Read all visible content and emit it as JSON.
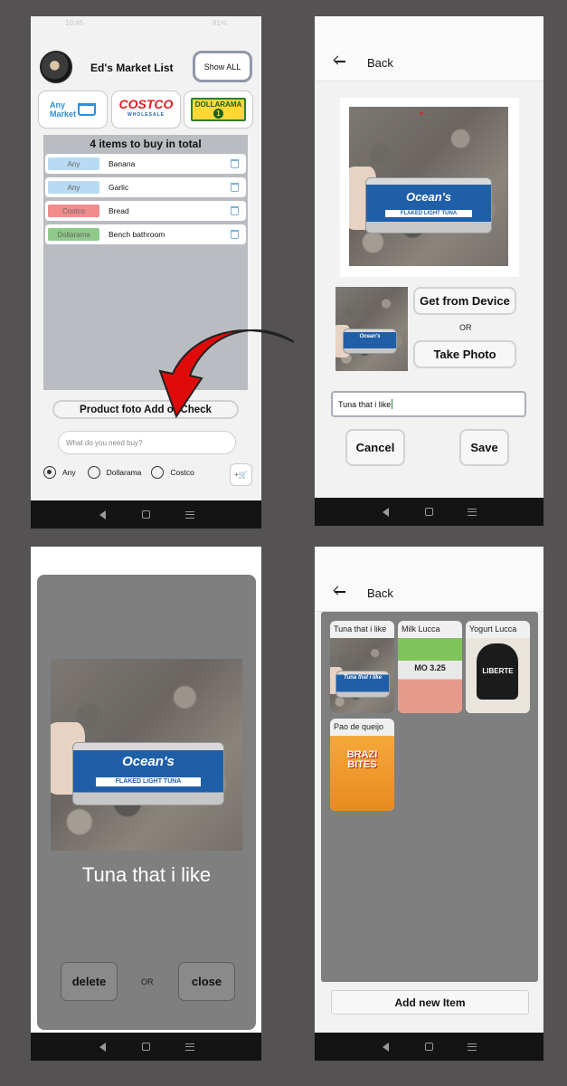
{
  "colors": {
    "background": "#545253",
    "any_tag": "#b8dbf3",
    "costco_tag": "#f28c8c",
    "dollarama_tag": "#8fca8a",
    "arrow": "#e10a0a",
    "dialog_gray": "#7f7f7f"
  },
  "screen1": {
    "status_time": "10:45",
    "status_right": "91%",
    "title": "Ed's Market List",
    "show_all": "Show ALL",
    "stores": [
      {
        "name": "Any Market",
        "line1": "Any",
        "line2": "Market",
        "icon": "cart-icon"
      },
      {
        "name": "Costco",
        "logo": "COSTCO",
        "sub": "WHOLESALE"
      },
      {
        "name": "Dollarama",
        "logo": "DOLLARAMA",
        "sub": "1"
      }
    ],
    "list_title": "4  items to buy in total",
    "items": [
      {
        "tag": "Any",
        "name": "Banana",
        "color": "#b8dbf3"
      },
      {
        "tag": "Any",
        "name": "Garlic",
        "color": "#b8dbf3"
      },
      {
        "tag": "Costco",
        "name": "Bread",
        "color": "#f28c8c"
      },
      {
        "tag": "Dollarama",
        "name": "Bench bathroom",
        "color": "#8fca8a"
      }
    ],
    "product_button": "Product foto Add or Check",
    "input_placeholder": "What do you need buy?",
    "radios": [
      {
        "label": "Any",
        "selected": true
      },
      {
        "label": "Dollarama",
        "selected": false
      },
      {
        "label": "Costco",
        "selected": false
      }
    ],
    "add_cart_label": "+"
  },
  "screen2": {
    "back": "Back",
    "tuna_brand": "Ocean's",
    "tuna_strip": "FLAKED LIGHT TUNA",
    "get_from_device": "Get from Device",
    "or": "OR",
    "take_photo": "Take Photo",
    "name_value": "Tuna that i like",
    "cancel": "Cancel",
    "save": "Save"
  },
  "screen3": {
    "tuna_brand": "Ocean's",
    "tuna_strip": "FLAKED LIGHT TUNA",
    "product_name": "Tuna that i like",
    "delete": "delete",
    "or": "OR",
    "close": "close"
  },
  "screen4": {
    "back": "Back",
    "tiles": [
      {
        "label": "Tuna that i like",
        "image": "tuna-can"
      },
      {
        "label": "Milk Lucca",
        "image": "milk-carton",
        "text": "MO 3.25"
      },
      {
        "label": "Yogurt Lucca",
        "image": "yogurt-tub",
        "text": "LIBERTE"
      },
      {
        "label": "Pao de queijo",
        "image": "snack-bag",
        "text": "BRAZI BITES"
      }
    ],
    "add_new": "Add new Item"
  }
}
